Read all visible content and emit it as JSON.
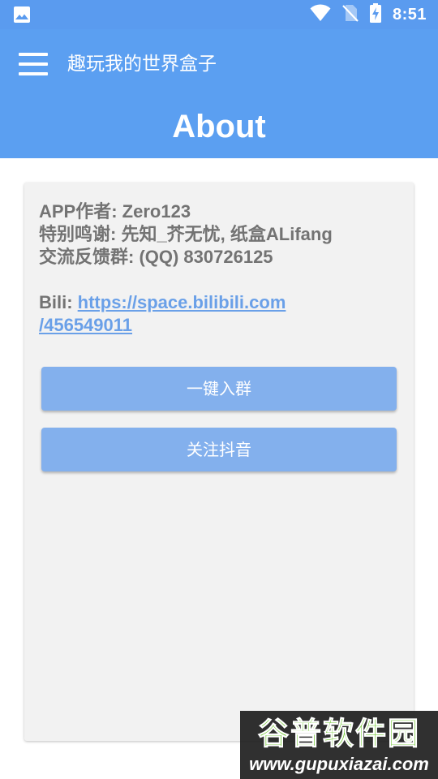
{
  "status_bar": {
    "time": "8:51",
    "icons": [
      "image-icon",
      "wifi-icon",
      "no-sim-icon",
      "battery-charging-icon"
    ]
  },
  "app_bar": {
    "title": "趣玩我的世界盒子",
    "heading": "About",
    "menu_icon": "hamburger-menu-icon"
  },
  "about": {
    "author": "APP作者: Zero123",
    "thanks": "特别鸣谢: 先知_芥无忧, 纸盒ALifang",
    "group": "交流反馈群: (QQ) 830726125",
    "bili_label": "Bili: ",
    "bili_link_part1": "https://space.bilibili.com",
    "bili_link_part2": "/456549011"
  },
  "buttons": {
    "join_group": "一键入群",
    "follow_douyin": "关注抖音"
  },
  "watermark": {
    "title": "谷普软件园",
    "url": "www.gupuxiazai.com"
  },
  "colors": {
    "primary": "#5b9ff1",
    "button": "#83b0ed",
    "card_bg": "#f2f2f2",
    "text": "#737373",
    "link": "#6aa0e8"
  }
}
